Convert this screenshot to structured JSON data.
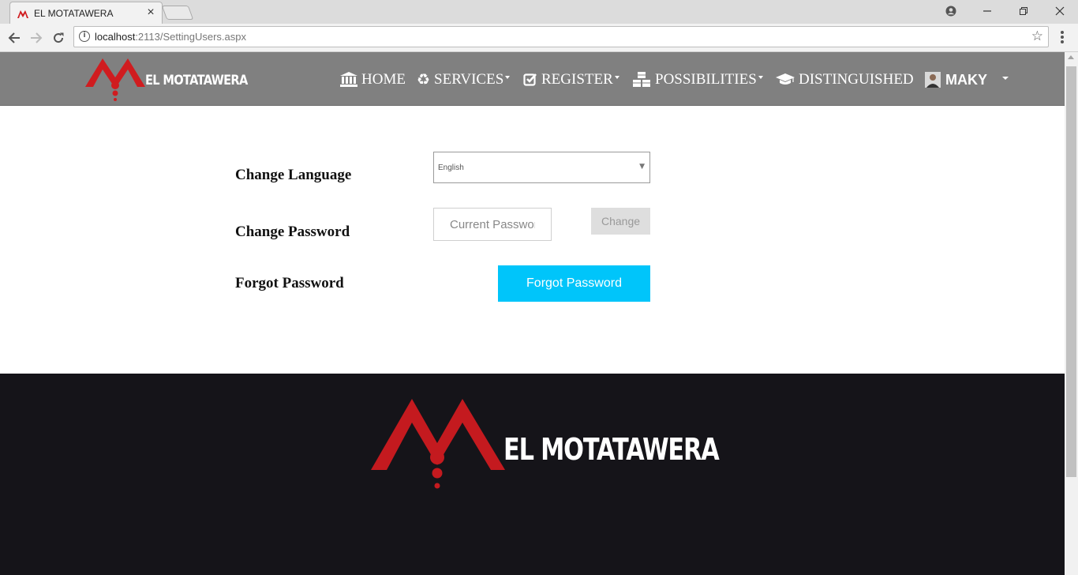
{
  "browser": {
    "tab_title": "EL MOTATAWERA",
    "tab_close": "×",
    "url_host": "localhost",
    "url_rest": ":2113/SettingUsers.aspx",
    "icons": [
      "back-arrow-icon",
      "forward-arrow-icon",
      "reload-icon",
      "info-icon",
      "star-icon",
      "kebab-menu-icon",
      "account-icon",
      "minimize-icon",
      "restore-icon",
      "close-icon"
    ]
  },
  "site": {
    "brand": "EL MOTATAWERA",
    "brand_color": "#d01c1f",
    "nav": {
      "home": "HOME",
      "services": "SERVICES",
      "register": "REGISTER",
      "possibilities": "POSSIBILITIES",
      "distinguished": "DISTINGUISHED",
      "user": "MAKY"
    },
    "nav_icons": {
      "home": "bank-icon",
      "services": "recycle-icon",
      "register": "check-square-icon",
      "possibilities": "cubes-icon",
      "distinguished": "graduation-cap-icon"
    },
    "navbar_color": "#808080"
  },
  "settings": {
    "language_label": "Change Language",
    "language_value": "English",
    "password_label": "Change Password",
    "password_placeholder": "Current Password",
    "change_button": "Change",
    "forgot_label": "Forgot Password",
    "forgot_button": "Forgot Password",
    "forgot_button_color": "#00c5fa"
  },
  "footer": {
    "brand": "EL MOTATAWERA",
    "background": "#151419"
  }
}
